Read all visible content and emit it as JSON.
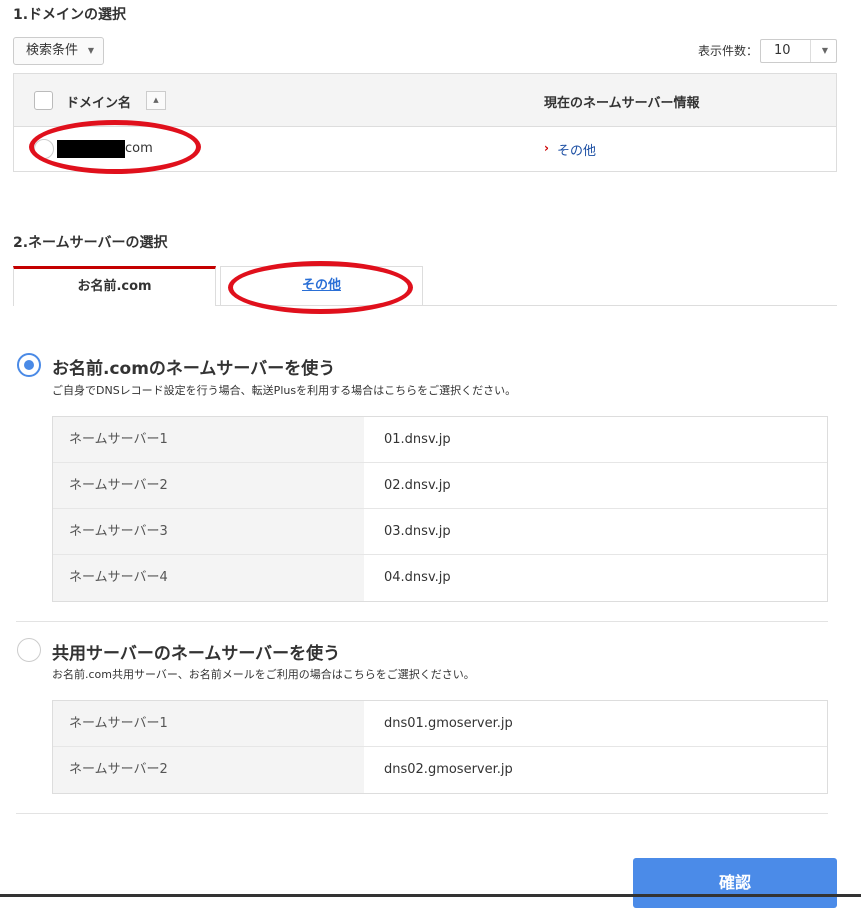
{
  "section1": {
    "title": "1.ドメインの選択",
    "search_label": "検索条件",
    "per_page_label": "表示件数：",
    "per_page_value": "10"
  },
  "domain_table": {
    "col_domain": "ドメイン名",
    "col_nameserver": "現在のネームサーバー情報",
    "rows": [
      {
        "domain_suffix": "com",
        "nameserver_link": "その他"
      }
    ]
  },
  "section2": {
    "title": "2.ネームサーバーの選択",
    "tabs": [
      {
        "label": "お名前.com"
      },
      {
        "label": "その他"
      }
    ]
  },
  "options": [
    {
      "title": "お名前.comのネームサーバーを使う",
      "desc": "ご自身でDNSレコード設定を行う場合、転送Plusを利用する場合はこちらをご選択ください。",
      "selected": true,
      "servers": [
        {
          "label": "ネームサーバー1",
          "value": "01.dnsv.jp"
        },
        {
          "label": "ネームサーバー2",
          "value": "02.dnsv.jp"
        },
        {
          "label": "ネームサーバー3",
          "value": "03.dnsv.jp"
        },
        {
          "label": "ネームサーバー4",
          "value": "04.dnsv.jp"
        }
      ]
    },
    {
      "title": "共用サーバーのネームサーバーを使う",
      "desc": "お名前.com共用サーバー、お名前メールをご利用の場合はこちらをご選択ください。",
      "selected": false,
      "servers": [
        {
          "label": "ネームサーバー1",
          "value": "dns01.gmoserver.jp"
        },
        {
          "label": "ネームサーバー2",
          "value": "dns02.gmoserver.jp"
        }
      ]
    }
  ],
  "confirm_label": "確認",
  "icons": {
    "dropdown": "chevron-down-icon",
    "sort": "sort-up-icon",
    "link_arrow": "chevron-right-icon"
  },
  "colors": {
    "accent_blue": "#4b8be8",
    "tab_active_red": "#c40000",
    "annotation_red": "#e0101c",
    "link_blue": "#1b4ea3"
  }
}
